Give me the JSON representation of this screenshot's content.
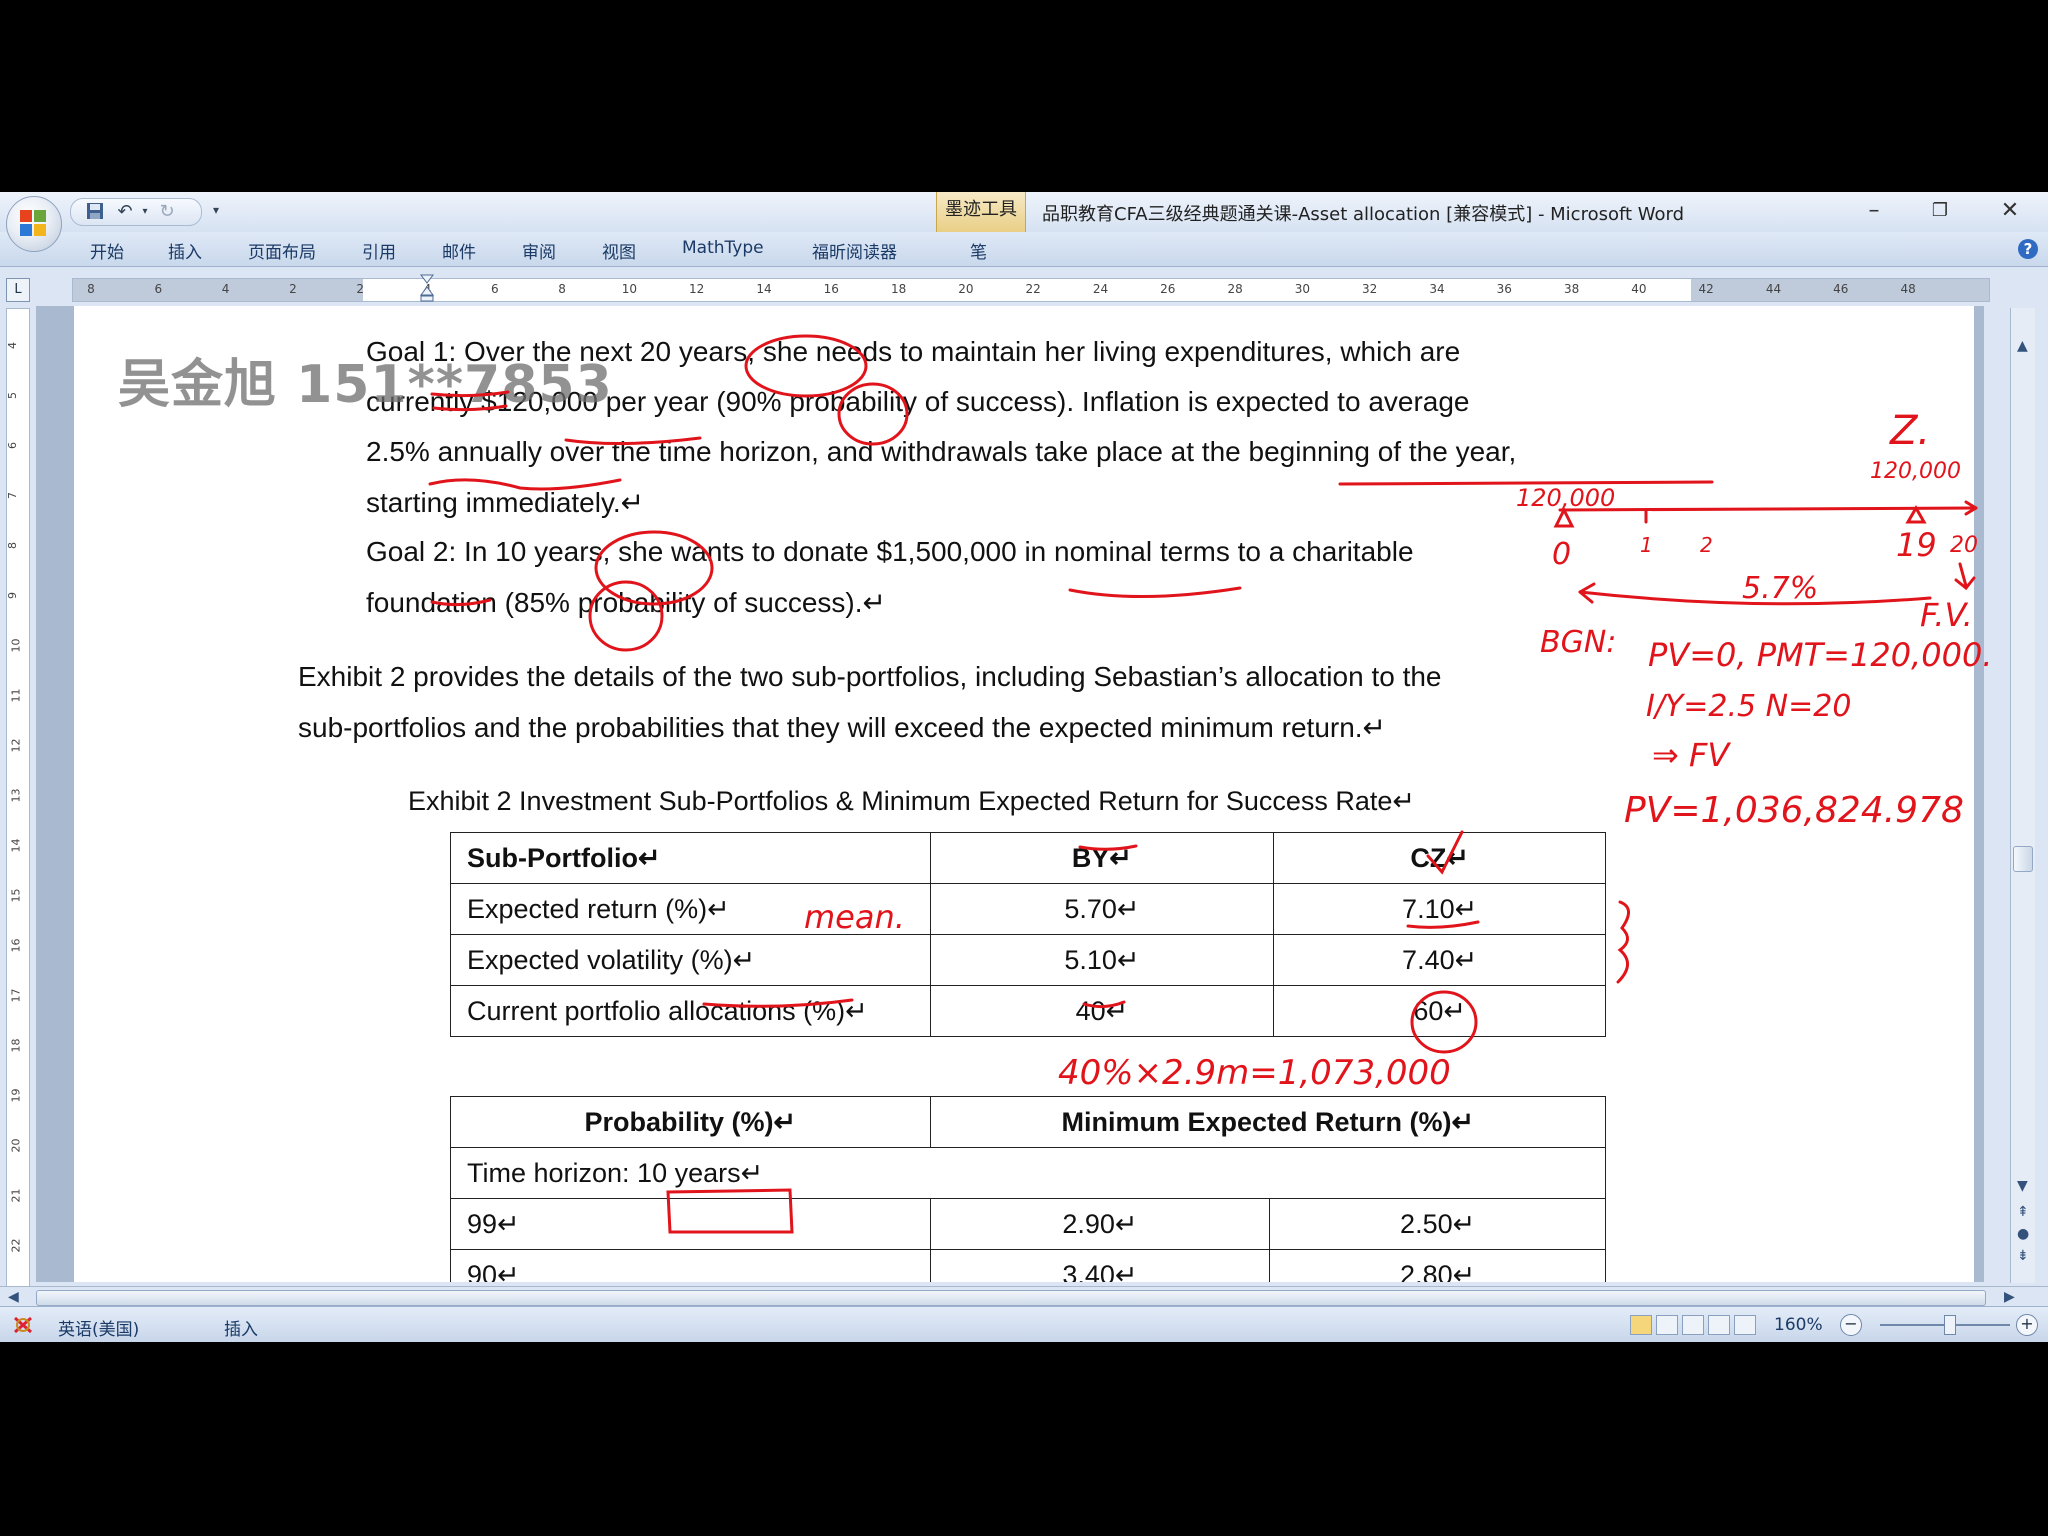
{
  "window": {
    "contextual_tab": "墨迹工具",
    "title": "品职教育CFA三级经典题通关课-Asset allocation [兼容模式] - Microsoft Word",
    "minimize": "–",
    "restore": "❐",
    "close": "✕"
  },
  "ribbon": {
    "tabs": [
      "开始",
      "插入",
      "页面布局",
      "引用",
      "邮件",
      "审阅",
      "视图",
      "MathType",
      "福昕阅读器",
      "笔"
    ],
    "help": "?"
  },
  "ruler": {
    "corner": "L",
    "numbers": [
      "8",
      "6",
      "4",
      "2",
      "2",
      "4",
      "6",
      "8",
      "10",
      "12",
      "14",
      "16",
      "18",
      "20",
      "22",
      "24",
      "26",
      "28",
      "30",
      "32",
      "34",
      "36",
      "38",
      "40",
      "42",
      "44",
      "46",
      "48"
    ],
    "vnumbers": [
      "4",
      "5",
      "6",
      "7",
      "8",
      "9",
      "10",
      "11",
      "12",
      "13",
      "14",
      "15",
      "16",
      "17",
      "18",
      "19",
      "20",
      "21",
      "22"
    ]
  },
  "watermark": {
    "name": "吴金旭",
    "code": "151**7853"
  },
  "document": {
    "goal1_lines": [
      "Goal 1: Over the next 20 years, she needs to maintain her living expenditures, which are",
      "currently $120,000 per year (90% probability of success). Inflation is expected to average",
      "2.5% annually over the time horizon, and withdrawals take place at the beginning of the year,",
      "starting immediately.↵"
    ],
    "goal2_lines": [
      "Goal 2: In 10 years, she wants to donate $1,500,000 in nominal terms to a charitable",
      "foundation (85% probability of success).↵"
    ],
    "exhibit_lines": [
      "Exhibit 2 provides the details of the two sub-portfolios, including Sebastian’s allocation to the",
      "sub-portfolios and the probabilities that they will exceed the expected minimum return.↵"
    ],
    "exhibit_title": "Exhibit 2 Investment Sub-Portfolios & Minimum Expected Return for Success Rate↵",
    "table1": {
      "header": [
        "Sub-Portfolio↵",
        "BY↵",
        "CZ↵"
      ],
      "rows": [
        [
          "Expected return (%)↵",
          "5.70↵",
          "7.10↵"
        ],
        [
          "Expected volatility (%)↵",
          "5.10↵",
          "7.40↵"
        ],
        [
          "Current portfolio allocations (%)↵",
          "40↵",
          "60↵"
        ]
      ]
    },
    "table2": {
      "header": [
        "Probability (%)↵",
        "Minimum Expected Return (%)↵"
      ],
      "horizon": "Time horizon: 10 years↵",
      "rows": [
        [
          "99↵",
          "2.90↵",
          "2.50↵"
        ],
        [
          "90↵",
          "3.40↵",
          "2.80↵"
        ]
      ]
    }
  },
  "annotations": {
    "z": "Z.",
    "z_amount": "120,000",
    "line_start": "120,000",
    "t0": "0",
    "t1": "1",
    "t2": "2",
    "t19": "19",
    "t20": "20",
    "rate": "5.7%",
    "fv_label": "F.V.",
    "bgn": "BGN:",
    "calc1": "PV=0, PMT=120,000.",
    "calc2": "I/Y=2.5   N=20",
    "calc3": "⇒ FV",
    "calc4": "PV=1,036,824.978",
    "mean": "mean.",
    "calc5": "40%×2.9m=1,073,000"
  },
  "statusbar": {
    "language": "英语(美国)",
    "mode": "插入",
    "zoom": "160%"
  },
  "colors": {
    "ink": "#e0141a",
    "ribbon_text": "#1b3a66"
  }
}
